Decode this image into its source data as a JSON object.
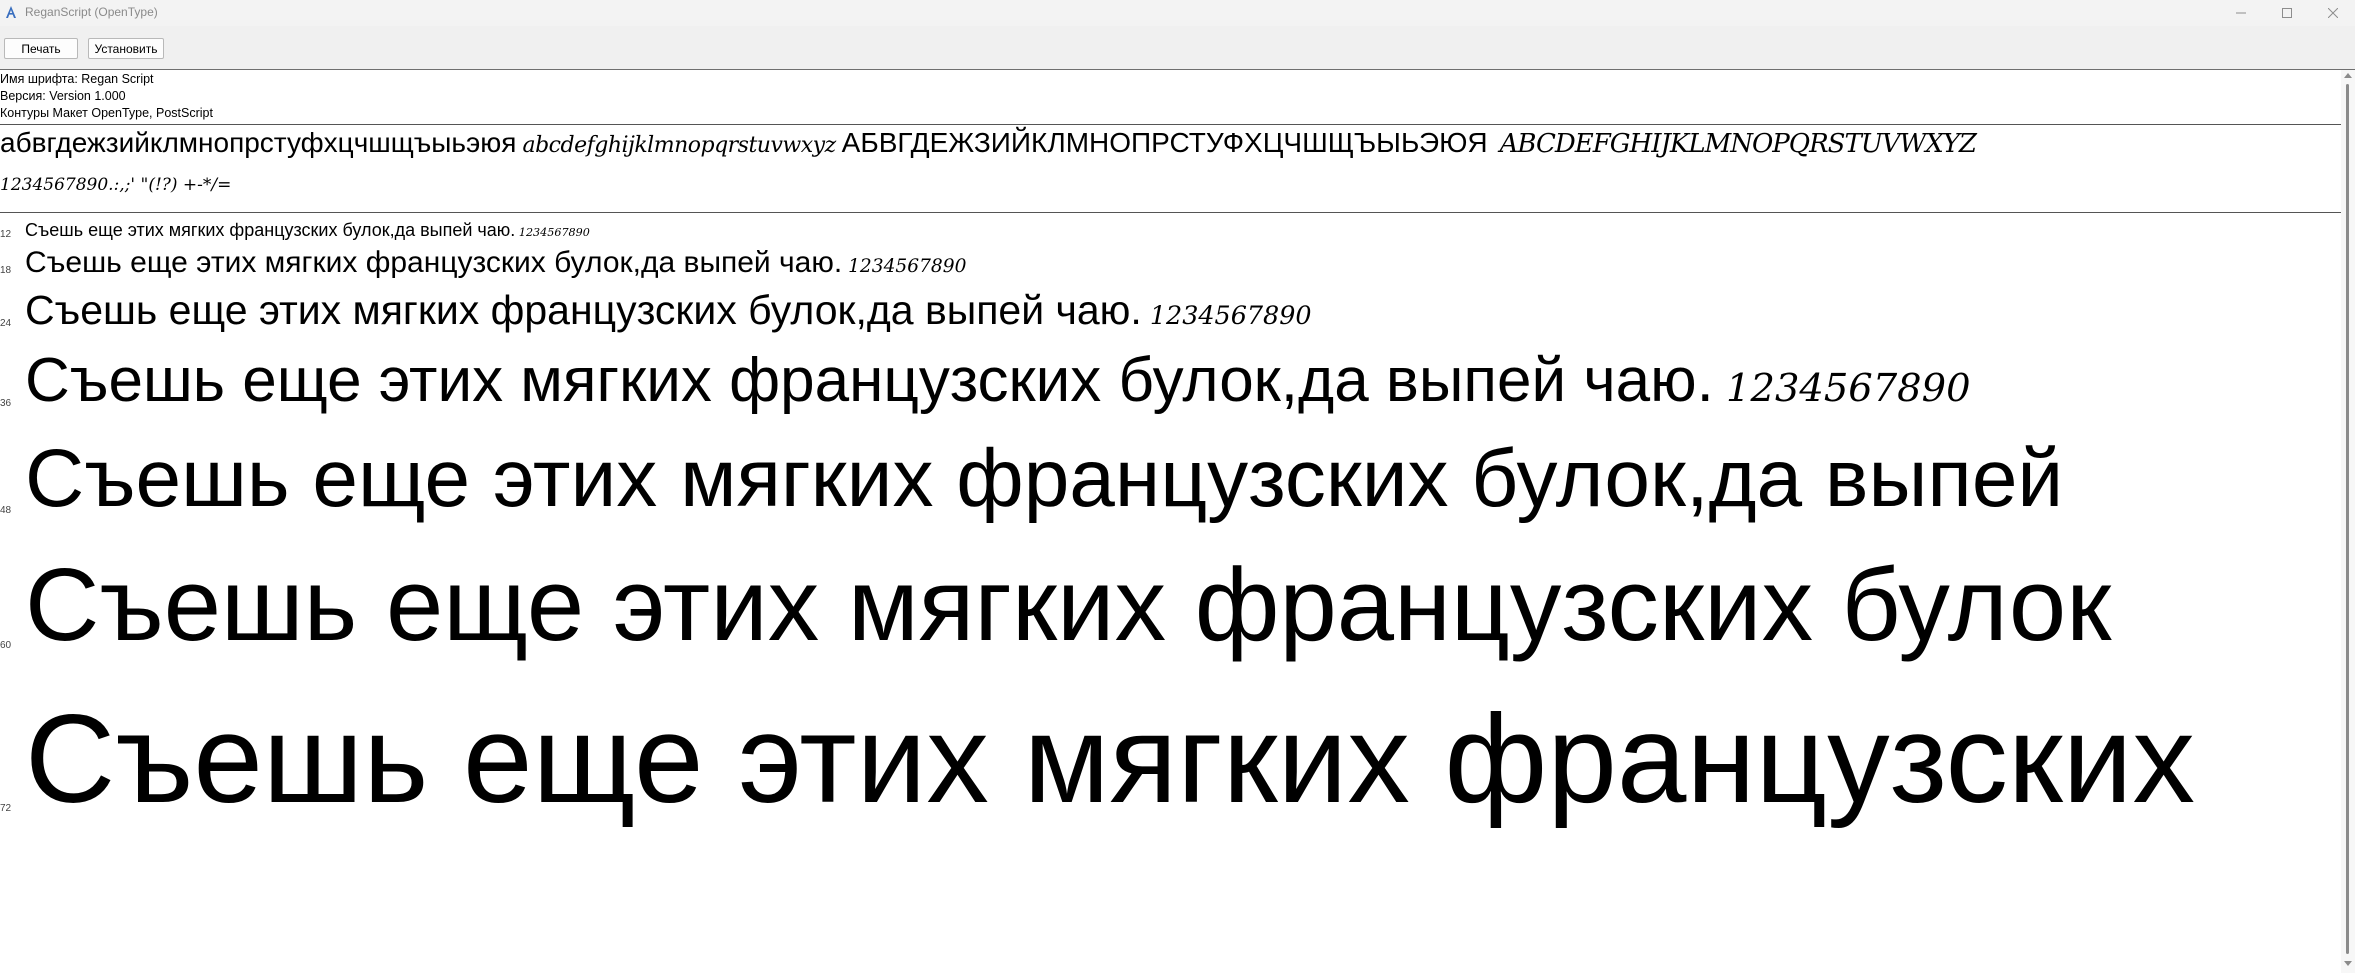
{
  "window": {
    "title": "ReganScript (OpenType)"
  },
  "toolbar": {
    "print_label": "Печать",
    "install_label": "Установить"
  },
  "info": {
    "font_name": "Имя шрифта: Regan Script",
    "version": "Версия: Version 1.000",
    "outlines": "Контуры Макет OpenType, PostScript"
  },
  "charset": {
    "lower_cyrillic": "абвгдежзийклмнопрстуфхцчшщъыьэюя",
    "lower_latin": "abcdefghijklmnopqrstuvwxyz",
    "upper_cyrillic": "АБВГДЕЖЗИЙКЛМНОПРСТУФХЦЧШЩЪЫЬЭЮЯ",
    "upper_latin": "ABCDEFGHIJKLMNOPQRSTUVWXYZ",
    "digits_punct": "1234567890.:,;' \"(!?) +-*/="
  },
  "samples": [
    {
      "size": "12",
      "text": "Съешь еще этих мягких французских булок,да выпей чаю.",
      "digits": " 1234567890"
    },
    {
      "size": "18",
      "text": "Съешь еще этих мягких французских булок,да выпей чаю.",
      "digits": " 1234567890"
    },
    {
      "size": "24",
      "text": "Съешь еще этих мягких французских булок,да выпей чаю.",
      "digits": " 1234567890"
    },
    {
      "size": "36",
      "text": "Съешь еще этих мягких французских булок,да выпей чаю.",
      "digits": " 1234567890"
    },
    {
      "size": "48",
      "text": "Съешь еще этих мягких французских булок,да выпей",
      "digits": ""
    },
    {
      "size": "60",
      "text": "Съешь еще этих мягких французских булок",
      "digits": ""
    },
    {
      "size": "72",
      "text": "Съешь еще этих мягких французских",
      "digits": ""
    }
  ]
}
